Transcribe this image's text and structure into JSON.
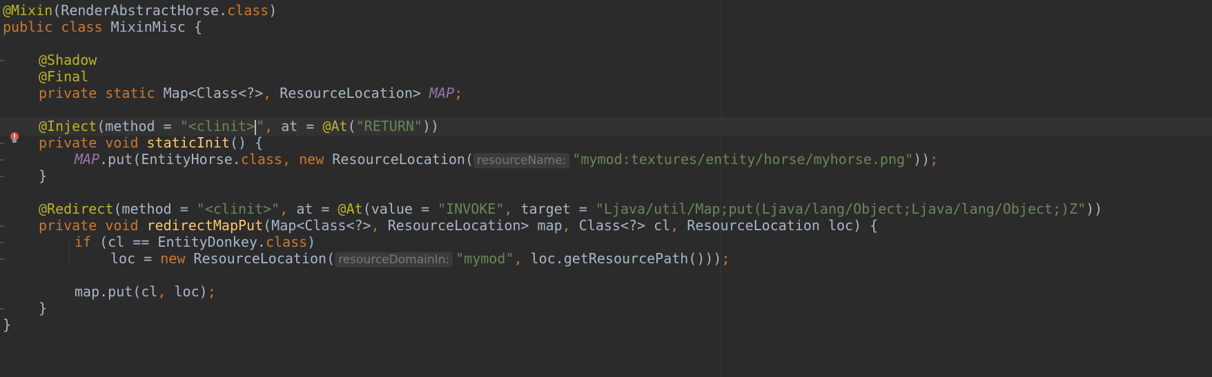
{
  "editor": {
    "lines": [
      {
        "id": "l1",
        "tokens": [
          {
            "t": "ann",
            "v": "@Mixin"
          },
          {
            "t": "plain",
            "v": "(RenderAbstractHorse."
          },
          {
            "t": "kw",
            "v": "class"
          },
          {
            "t": "plain",
            "v": ")"
          }
        ]
      },
      {
        "id": "l2",
        "tokens": [
          {
            "t": "kw",
            "v": "public class "
          },
          {
            "t": "plain",
            "v": "MixinMisc {"
          }
        ]
      },
      {
        "id": "l3",
        "tokens": []
      },
      {
        "id": "l4",
        "tokens": [
          {
            "t": "ann",
            "v": "@Shadow"
          }
        ]
      },
      {
        "id": "l5",
        "tokens": [
          {
            "t": "ann",
            "v": "@Final"
          }
        ]
      },
      {
        "id": "l6",
        "tokens": [
          {
            "t": "kw",
            "v": "private static "
          },
          {
            "t": "plain",
            "v": "Map<Class<?>"
          },
          {
            "t": "kw",
            "v": ", "
          },
          {
            "t": "plain",
            "v": "ResourceLocation> "
          },
          {
            "t": "static",
            "v": "MAP"
          },
          {
            "t": "kw",
            "v": ";"
          }
        ]
      },
      {
        "id": "l7",
        "tokens": []
      },
      {
        "id": "l8",
        "tokens": [
          {
            "t": "ann",
            "v": "@Inject"
          },
          {
            "t": "plain",
            "v": "(method = "
          },
          {
            "t": "str",
            "v": "\"<clinit>"
          },
          {
            "t": "caret",
            "v": ""
          },
          {
            "t": "str",
            "v": "\""
          },
          {
            "t": "kw",
            "v": ", "
          },
          {
            "t": "plain",
            "v": "at = "
          },
          {
            "t": "ann",
            "v": "@At"
          },
          {
            "t": "plain",
            "v": "("
          },
          {
            "t": "str",
            "v": "\"RETURN\""
          },
          {
            "t": "plain",
            "v": "))"
          }
        ]
      },
      {
        "id": "l9",
        "tokens": [
          {
            "t": "kw",
            "v": "private void "
          },
          {
            "t": "fn",
            "v": "staticInit"
          },
          {
            "t": "plain",
            "v": "() {"
          }
        ]
      },
      {
        "id": "l10",
        "tokens": [
          {
            "t": "static",
            "v": "MAP"
          },
          {
            "t": "plain",
            "v": ".put(EntityHorse."
          },
          {
            "t": "kw",
            "v": "class, new "
          },
          {
            "t": "plain",
            "v": "ResourceLocation("
          },
          {
            "t": "hint",
            "v": "resourceName:"
          },
          {
            "t": "str",
            "v": "\"mymod:textures/entity/horse/myhorse.png\""
          },
          {
            "t": "plain",
            "v": "))"
          },
          {
            "t": "kw",
            "v": ";"
          }
        ]
      },
      {
        "id": "l11",
        "tokens": [
          {
            "t": "plain",
            "v": "}"
          }
        ]
      },
      {
        "id": "l12",
        "tokens": []
      },
      {
        "id": "l13",
        "tokens": [
          {
            "t": "ann",
            "v": "@Redirect"
          },
          {
            "t": "plain",
            "v": "(method = "
          },
          {
            "t": "str",
            "v": "\"<clinit>\""
          },
          {
            "t": "kw",
            "v": ", "
          },
          {
            "t": "plain",
            "v": "at = "
          },
          {
            "t": "ann",
            "v": "@At"
          },
          {
            "t": "plain",
            "v": "(value = "
          },
          {
            "t": "str",
            "v": "\"INVOKE\""
          },
          {
            "t": "kw",
            "v": ", "
          },
          {
            "t": "plain",
            "v": "target = "
          },
          {
            "t": "str",
            "v": "\"Ljava/util/Map;put(Ljava/lang/Object;Ljava/lang/Object;)Z\""
          },
          {
            "t": "plain",
            "v": "))"
          }
        ]
      },
      {
        "id": "l14",
        "tokens": [
          {
            "t": "kw",
            "v": "private void "
          },
          {
            "t": "fn",
            "v": "redirectMapPut"
          },
          {
            "t": "plain",
            "v": "(Map<Class<?>"
          },
          {
            "t": "kw",
            "v": ", "
          },
          {
            "t": "plain",
            "v": "ResourceLocation> map"
          },
          {
            "t": "kw",
            "v": ", "
          },
          {
            "t": "plain",
            "v": "Class<?> cl"
          },
          {
            "t": "kw",
            "v": ", "
          },
          {
            "t": "plain",
            "v": "ResourceLocation loc) {"
          }
        ]
      },
      {
        "id": "l15",
        "tokens": [
          {
            "t": "kw",
            "v": "if "
          },
          {
            "t": "plain",
            "v": "(cl == EntityDonkey."
          },
          {
            "t": "kw",
            "v": "class"
          },
          {
            "t": "plain",
            "v": ")"
          }
        ]
      },
      {
        "id": "l16",
        "tokens": [
          {
            "t": "plain",
            "v": "loc = "
          },
          {
            "t": "kw",
            "v": "new "
          },
          {
            "t": "plain",
            "v": "ResourceLocation("
          },
          {
            "t": "hint",
            "v": "resourceDomainIn:"
          },
          {
            "t": "str",
            "v": "\"mymod\""
          },
          {
            "t": "kw",
            "v": ", "
          },
          {
            "t": "plain",
            "v": "loc.getResourcePath()))"
          },
          {
            "t": "kw",
            "v": ";"
          }
        ]
      },
      {
        "id": "l17",
        "tokens": []
      },
      {
        "id": "l18",
        "tokens": [
          {
            "t": "plain",
            "v": "map.put(cl"
          },
          {
            "t": "kw",
            "v": ", "
          },
          {
            "t": "plain",
            "v": "loc)"
          },
          {
            "t": "kw",
            "v": ";"
          }
        ]
      },
      {
        "id": "l19",
        "tokens": [
          {
            "t": "plain",
            "v": "}"
          }
        ]
      },
      {
        "id": "l20",
        "tokens": [
          {
            "t": "plain",
            "v": "}"
          }
        ]
      }
    ]
  },
  "colors": {
    "background": "#2b2b2b",
    "annotation": "#bbb529",
    "keyword": "#cc7832",
    "string": "#6a8759",
    "static_field": "#9876aa",
    "method": "#ffc66d",
    "plain": "#a9b7c6"
  },
  "gutter": {
    "intention_icon": "error-bulb-icon"
  }
}
